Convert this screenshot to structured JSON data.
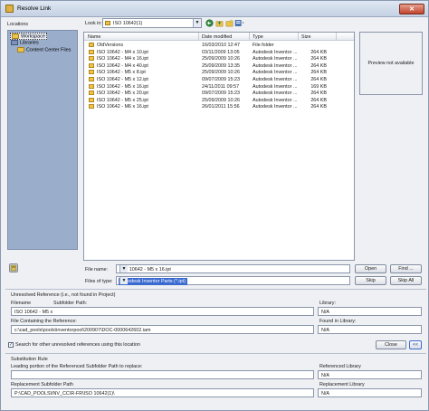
{
  "window": {
    "title": "Resolve Link",
    "close_glyph": "✕"
  },
  "locations": {
    "heading": "Locations",
    "items": [
      {
        "label": "Workspace",
        "icon": "folder-icon",
        "selected": true
      },
      {
        "label": "Libraries",
        "icon": "library-icon",
        "selected": false
      },
      {
        "label": "Content Center Files",
        "icon": "folder-icon",
        "selected": false
      }
    ]
  },
  "lookin": {
    "label": "Look in:",
    "value": "ISO 10642(1)"
  },
  "filelist": {
    "columns": [
      "Name",
      "Date modified",
      "Type",
      "Size"
    ],
    "rows": [
      {
        "name": "OldVersions",
        "date": "16/03/2010 12:47",
        "type": "File folder",
        "size": "",
        "icon": "folder-icon"
      },
      {
        "name": "ISO 10642 - M4 x  10.ipt",
        "date": "03/11/2009 13:05",
        "type": "Autodesk Inventor ...",
        "size": "264 KB",
        "icon": "ipt-file-icon"
      },
      {
        "name": "ISO 10642 - M4 x  16.ipt",
        "date": "25/09/2009 10:26",
        "type": "Autodesk Inventor ...",
        "size": "264 KB",
        "icon": "ipt-file-icon"
      },
      {
        "name": "ISO 10642 - M4 x  40.ipt",
        "date": "25/09/2009 13:35",
        "type": "Autodesk Inventor ...",
        "size": "264 KB",
        "icon": "ipt-file-icon"
      },
      {
        "name": "ISO 10642 - M5 x  8.ipt",
        "date": "25/09/2009 10:26",
        "type": "Autodesk Inventor ...",
        "size": "264 KB",
        "icon": "ipt-file-icon"
      },
      {
        "name": "ISO 10642 - M5 x  12.ipt",
        "date": "09/07/2009 15:23",
        "type": "Autodesk Inventor ...",
        "size": "264 KB",
        "icon": "ipt-file-icon"
      },
      {
        "name": "ISO 10642 - M5 x  16.ipt",
        "date": "24/11/2011 09:57",
        "type": "Autodesk Inventor ...",
        "size": "169 KB",
        "icon": "ipt-file-icon"
      },
      {
        "name": "ISO 10642 - M5 x  20.ipt",
        "date": "09/07/2009 15:23",
        "type": "Autodesk Inventor ...",
        "size": "264 KB",
        "icon": "ipt-file-icon"
      },
      {
        "name": "ISO 10642 - M5 x  25.ipt",
        "date": "25/09/2009 10:26",
        "type": "Autodesk Inventor ...",
        "size": "264 KB",
        "icon": "ipt-file-icon"
      },
      {
        "name": "ISO 10642 - M6 x  16.ipt",
        "date": "26/01/2011 15:56",
        "type": "Autodesk Inventor ...",
        "size": "264 KB",
        "icon": "ipt-file-icon"
      }
    ]
  },
  "preview": {
    "text": "Preview not available"
  },
  "filename": {
    "label": "File name:",
    "value": "ISO 10642 - M5 x  16.ipt"
  },
  "filetype": {
    "label": "Files of type:",
    "value": "Autodesk Inventor Parts (*.ipt)"
  },
  "buttons": {
    "open": "Open",
    "find": "Find ...",
    "skip": "Skip",
    "skip_all": "Skip All",
    "prev": "<<"
  },
  "unresolved": {
    "heading": "Unresolved Reference (i.e., not found in Project)",
    "filename_label": "Filename",
    "subfolder_label": "Subfolder Path:",
    "library_label": "Library:",
    "filename_value": "ISO 10642 - M5 x",
    "library_value": "N/A",
    "containing_label": "File Containing the Reference:",
    "found_in_label": "Found in Library:",
    "containing_value": "c:\\cad_pools\\pools\\inventorpool\\200907\\DOC-0000642602.iam",
    "found_in_value": "N/A"
  },
  "search_other": {
    "label": "Search for other unresolved references using this location",
    "checked": true
  },
  "buttons2": {
    "close": "Close"
  },
  "substitution": {
    "heading": "Substitution Rule",
    "leading_label": "Leading portion of the Referenced Subfolder Path to replace:",
    "ref_library_label": "Referenced Library",
    "ref_library_value": "N/A",
    "replacement_label": "Replacement Subfolder Path",
    "replacement_library_label": "Replacement Library",
    "replacement_value": "P:\\CAD_POOLS\\INV_CC\\R-FR\\ISO 10642(1)\\",
    "replacement_library_value": "N/A"
  }
}
